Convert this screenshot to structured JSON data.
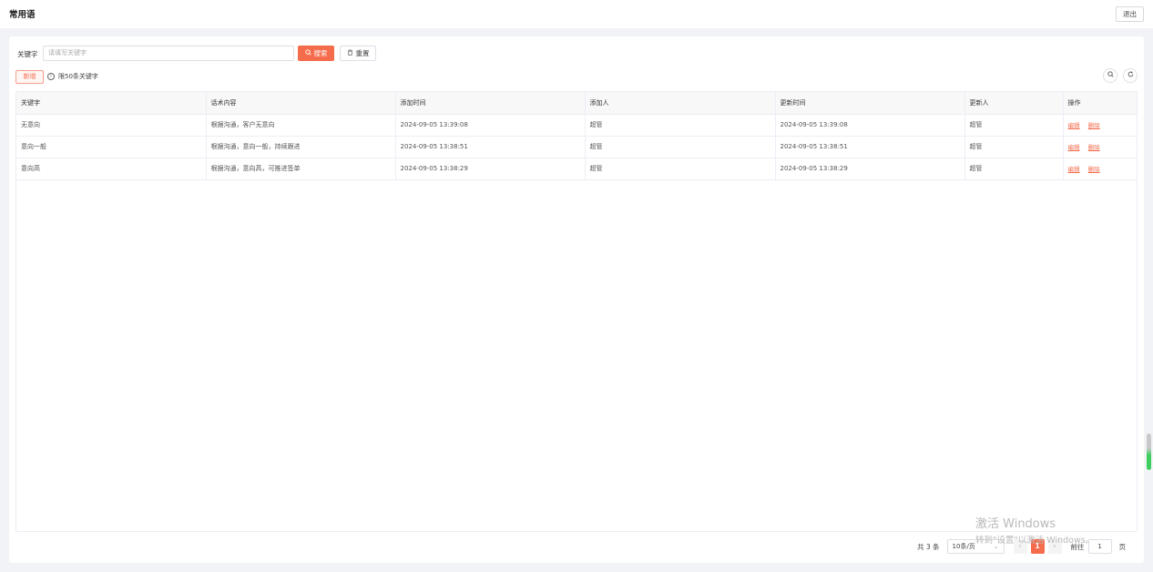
{
  "header": {
    "title": "常用语",
    "logout_label": "退出"
  },
  "search": {
    "label": "关键字",
    "placeholder": "请填写关键字",
    "search_label": "搜索",
    "reset_label": "重置"
  },
  "toolbar": {
    "add_label": "新增",
    "limit_note": "限50条关键字"
  },
  "table": {
    "columns": [
      "关键字",
      "话术内容",
      "添加时间",
      "添加人",
      "更新时间",
      "更新人",
      "操作"
    ],
    "rows": [
      {
        "keyword": "无意向",
        "content": "根据沟通，客户无意向",
        "added_at": "2024-09-05 13:39:08",
        "added_by": "超管",
        "updated_at": "2024-09-05 13:39:08",
        "updated_by": "超管"
      },
      {
        "keyword": "意向一般",
        "content": "根据沟通，意向一般，持续跟进",
        "added_at": "2024-09-05 13:38:51",
        "added_by": "超管",
        "updated_at": "2024-09-05 13:38:51",
        "updated_by": "超管"
      },
      {
        "keyword": "意向高",
        "content": "根据沟通，意向高，可推进签单",
        "added_at": "2024-09-05 13:38:29",
        "added_by": "超管",
        "updated_at": "2024-09-05 13:38:29",
        "updated_by": "超管"
      }
    ],
    "edit_label": "编辑",
    "delete_label": "删除"
  },
  "pagination": {
    "total": "共 3 条",
    "page_size": "10条/页",
    "current_page": "1",
    "goto_label": "前往",
    "goto_value": "1",
    "page_suffix": "页"
  },
  "watermark": {
    "line1": "激活 Windows",
    "line2": "转到\"设置\"以激活 Windows。"
  },
  "colors": {
    "accent": "#f56c4c",
    "background": "#f2f3f7"
  }
}
